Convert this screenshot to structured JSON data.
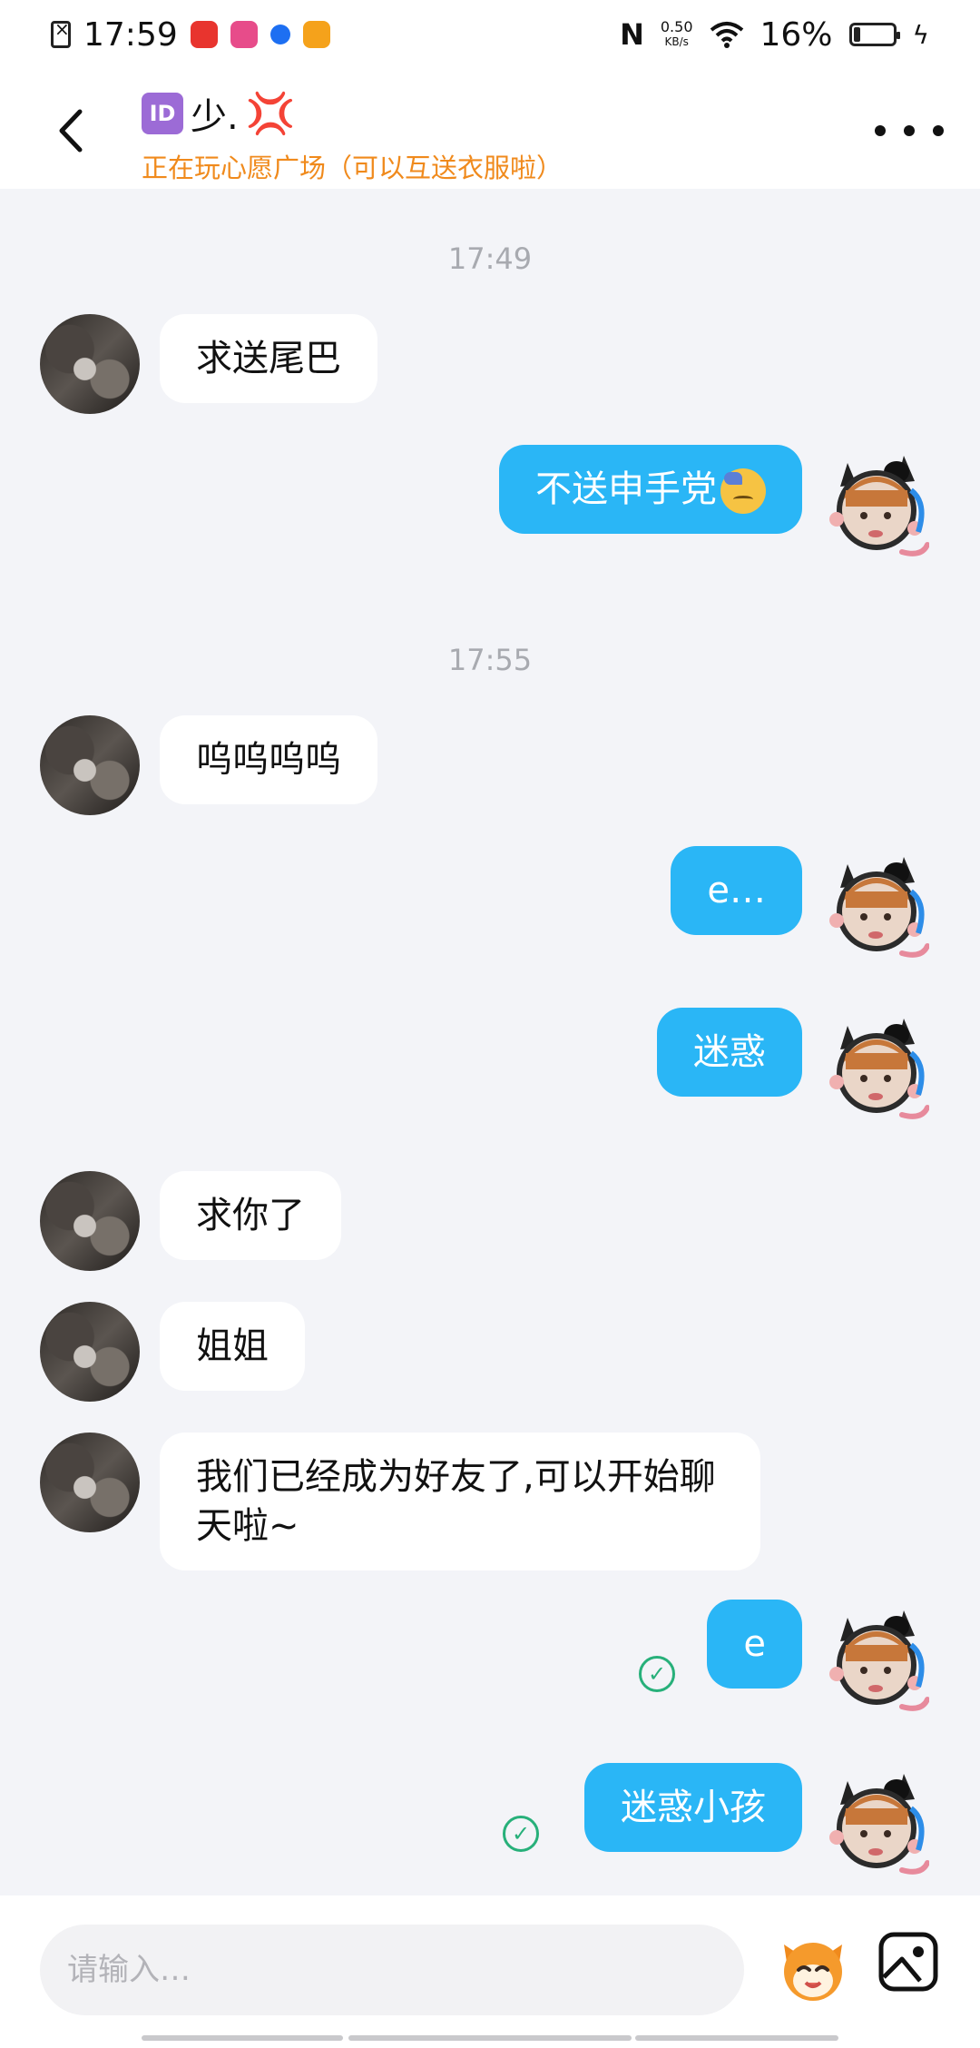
{
  "status_bar": {
    "time": "17:59",
    "net_speed_value": "0.50",
    "net_speed_unit": "KB/s",
    "battery": "16%",
    "battery_level": 0.16,
    "app_icon_colors": [
      "#e8342e",
      "#e74c8a",
      "#1d6ff2",
      "#f5a21b"
    ]
  },
  "header": {
    "badge": "ID",
    "name": "少.",
    "name_suffix_icon": "anger-icon",
    "activity": "正在玩心愿广场（可以互送衣服啦）"
  },
  "messages": [
    {
      "type": "time",
      "text": "17:49"
    },
    {
      "type": "msg",
      "side": "left",
      "text": "求送尾巴"
    },
    {
      "type": "msg",
      "side": "right",
      "text": "不送申手党",
      "emoji": "downcast-sweat-icon"
    },
    {
      "type": "time",
      "text": "17:55"
    },
    {
      "type": "msg",
      "side": "left",
      "text": "呜呜呜呜"
    },
    {
      "type": "msg",
      "side": "right",
      "text": "e…"
    },
    {
      "type": "msg",
      "side": "right",
      "text": "迷惑"
    },
    {
      "type": "msg",
      "side": "left",
      "text": "求你了"
    },
    {
      "type": "msg",
      "side": "left",
      "text": "姐姐"
    },
    {
      "type": "msg",
      "side": "left",
      "text": "我们已经成为好友了,可以开始聊天啦~"
    },
    {
      "type": "msg",
      "side": "right",
      "text": "e",
      "status": "read-check-icon"
    },
    {
      "type": "msg",
      "side": "right",
      "text": "迷惑小孩",
      "status": "read-check-icon"
    }
  ],
  "input": {
    "placeholder": "请输入…",
    "value": ""
  },
  "colors": {
    "accent": "#2ab6f6",
    "activity_text": "#f08a1c",
    "check": "#27b07a",
    "background": "#f3f4f8"
  }
}
